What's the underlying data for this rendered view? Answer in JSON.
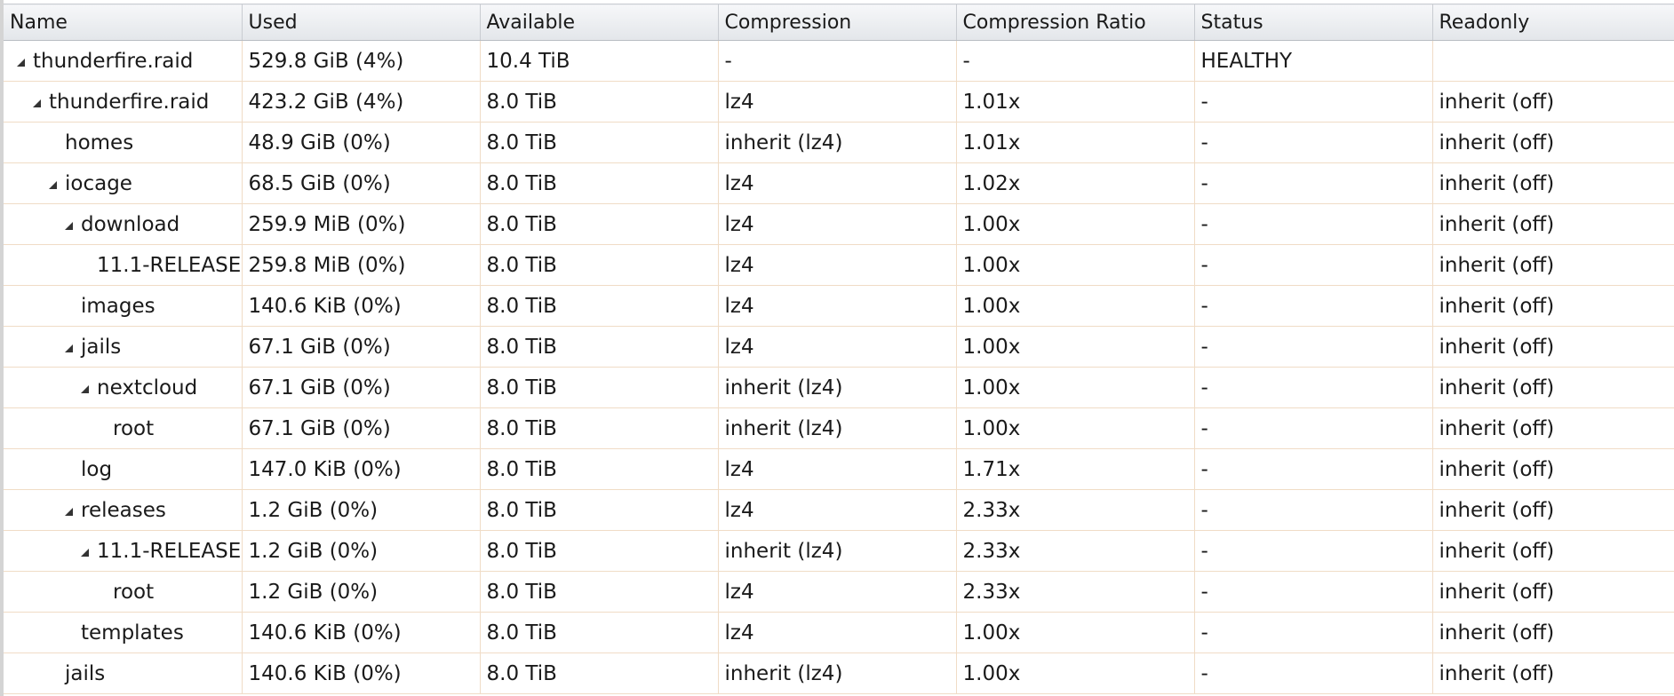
{
  "columns": [
    "Name",
    "Used",
    "Available",
    "Compression",
    "Compression Ratio",
    "Status",
    "Readonly"
  ],
  "rows": [
    {
      "name": "thunderfire.raid",
      "level": 0,
      "expanded": true,
      "used": "529.8 GiB (4%)",
      "available": "10.4 TiB",
      "compression": "-",
      "ratio": "-",
      "status": "HEALTHY",
      "readonly": ""
    },
    {
      "name": "thunderfire.raid",
      "level": 1,
      "expanded": true,
      "used": "423.2 GiB (4%)",
      "available": "8.0 TiB",
      "compression": "lz4",
      "ratio": "1.01x",
      "status": "-",
      "readonly": "inherit (off)"
    },
    {
      "name": "homes",
      "level": 2,
      "expanded": false,
      "used": "48.9 GiB (0%)",
      "available": "8.0 TiB",
      "compression": "inherit (lz4)",
      "ratio": "1.01x",
      "status": "-",
      "readonly": "inherit (off)"
    },
    {
      "name": "iocage",
      "level": 2,
      "expanded": true,
      "used": "68.5 GiB (0%)",
      "available": "8.0 TiB",
      "compression": "lz4",
      "ratio": "1.02x",
      "status": "-",
      "readonly": "inherit (off)"
    },
    {
      "name": "download",
      "level": 3,
      "expanded": true,
      "used": "259.9 MiB (0%)",
      "available": "8.0 TiB",
      "compression": "lz4",
      "ratio": "1.00x",
      "status": "-",
      "readonly": "inherit (off)"
    },
    {
      "name": "11.1-RELEASE",
      "level": 4,
      "expanded": false,
      "used": "259.8 MiB (0%)",
      "available": "8.0 TiB",
      "compression": "lz4",
      "ratio": "1.00x",
      "status": "-",
      "readonly": "inherit (off)"
    },
    {
      "name": "images",
      "level": 3,
      "expanded": false,
      "used": "140.6 KiB (0%)",
      "available": "8.0 TiB",
      "compression": "lz4",
      "ratio": "1.00x",
      "status": "-",
      "readonly": "inherit (off)"
    },
    {
      "name": "jails",
      "level": 3,
      "expanded": true,
      "used": "67.1 GiB (0%)",
      "available": "8.0 TiB",
      "compression": "lz4",
      "ratio": "1.00x",
      "status": "-",
      "readonly": "inherit (off)"
    },
    {
      "name": "nextcloud",
      "level": 4,
      "expanded": true,
      "used": "67.1 GiB (0%)",
      "available": "8.0 TiB",
      "compression": "inherit (lz4)",
      "ratio": "1.00x",
      "status": "-",
      "readonly": "inherit (off)"
    },
    {
      "name": "root",
      "level": 5,
      "expanded": false,
      "used": "67.1 GiB (0%)",
      "available": "8.0 TiB",
      "compression": "inherit (lz4)",
      "ratio": "1.00x",
      "status": "-",
      "readonly": "inherit (off)"
    },
    {
      "name": "log",
      "level": 3,
      "expanded": false,
      "used": "147.0 KiB (0%)",
      "available": "8.0 TiB",
      "compression": "lz4",
      "ratio": "1.71x",
      "status": "-",
      "readonly": "inherit (off)"
    },
    {
      "name": "releases",
      "level": 3,
      "expanded": true,
      "used": "1.2 GiB (0%)",
      "available": "8.0 TiB",
      "compression": "lz4",
      "ratio": "2.33x",
      "status": "-",
      "readonly": "inherit (off)"
    },
    {
      "name": "11.1-RELEASE",
      "level": 4,
      "expanded": true,
      "used": "1.2 GiB (0%)",
      "available": "8.0 TiB",
      "compression": "inherit (lz4)",
      "ratio": "2.33x",
      "status": "-",
      "readonly": "inherit (off)"
    },
    {
      "name": "root",
      "level": 5,
      "expanded": false,
      "used": "1.2 GiB (0%)",
      "available": "8.0 TiB",
      "compression": "lz4",
      "ratio": "2.33x",
      "status": "-",
      "readonly": "inherit (off)"
    },
    {
      "name": "templates",
      "level": 3,
      "expanded": false,
      "used": "140.6 KiB (0%)",
      "available": "8.0 TiB",
      "compression": "lz4",
      "ratio": "1.00x",
      "status": "-",
      "readonly": "inherit (off)"
    },
    {
      "name": "jails",
      "level": 2,
      "expanded": false,
      "used": "140.6 KiB (0%)",
      "available": "8.0 TiB",
      "compression": "inherit (lz4)",
      "ratio": "1.00x",
      "status": "-",
      "readonly": "inherit (off)"
    }
  ],
  "icons": {
    "expanded": "triangle-expanded-icon"
  },
  "colors": {
    "grid_line": "#f0dcc6",
    "header_bg": "#e3e6ea"
  }
}
